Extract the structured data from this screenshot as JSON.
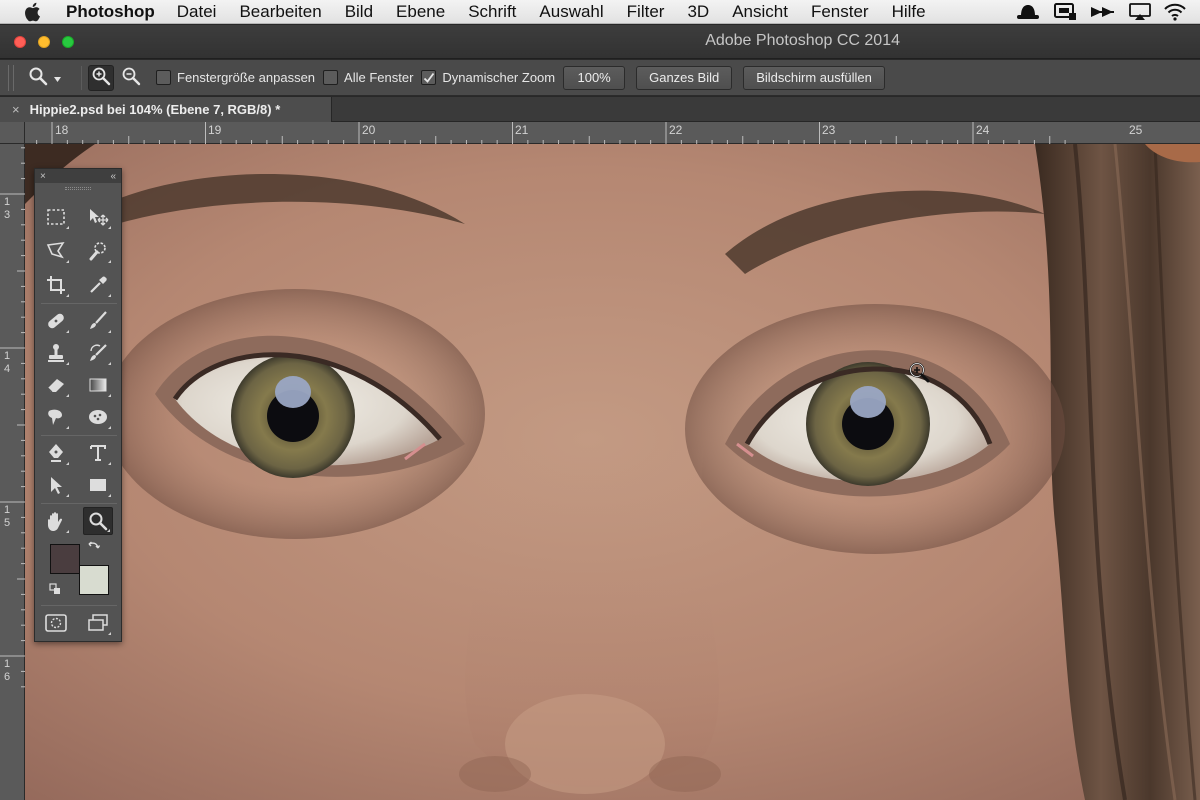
{
  "menubar": {
    "app": "Photoshop",
    "items": [
      "Datei",
      "Bearbeiten",
      "Bild",
      "Ebene",
      "Schrift",
      "Auswahl",
      "Filter",
      "3D",
      "Ansicht",
      "Fenster",
      "Hilfe"
    ]
  },
  "window": {
    "title": "Adobe Photoshop CC 2014"
  },
  "options": {
    "resize_windows": "Fenstergröße anpassen",
    "resize_windows_checked": false,
    "all_windows": "Alle Fenster",
    "all_windows_checked": false,
    "dynamic_zoom": "Dynamischer Zoom",
    "dynamic_zoom_checked": true,
    "zoom_value": "100%",
    "fit_screen": "Ganzes Bild",
    "fill_screen": "Bildschirm ausfüllen"
  },
  "document": {
    "tab_title": "Hippie2.psd bei 104% (Ebene 7, RGB/8) *",
    "close_glyph": "×"
  },
  "rulers": {
    "top": [
      "18",
      "19",
      "20",
      "21",
      "22",
      "23",
      "24",
      "25"
    ],
    "left": [
      "1\n3",
      "1\n4",
      "1\n5",
      "1\n6"
    ]
  },
  "toolbox": {
    "close_glyph": "×",
    "collapse_glyph": "«",
    "foreground_color": "#4a3d3f",
    "background_color": "#d8dcd0",
    "selected_tool": "zoom-tool"
  },
  "colors": {
    "accent_checkbox": "#e6e6e6",
    "skin_tone": "#b98a72"
  }
}
